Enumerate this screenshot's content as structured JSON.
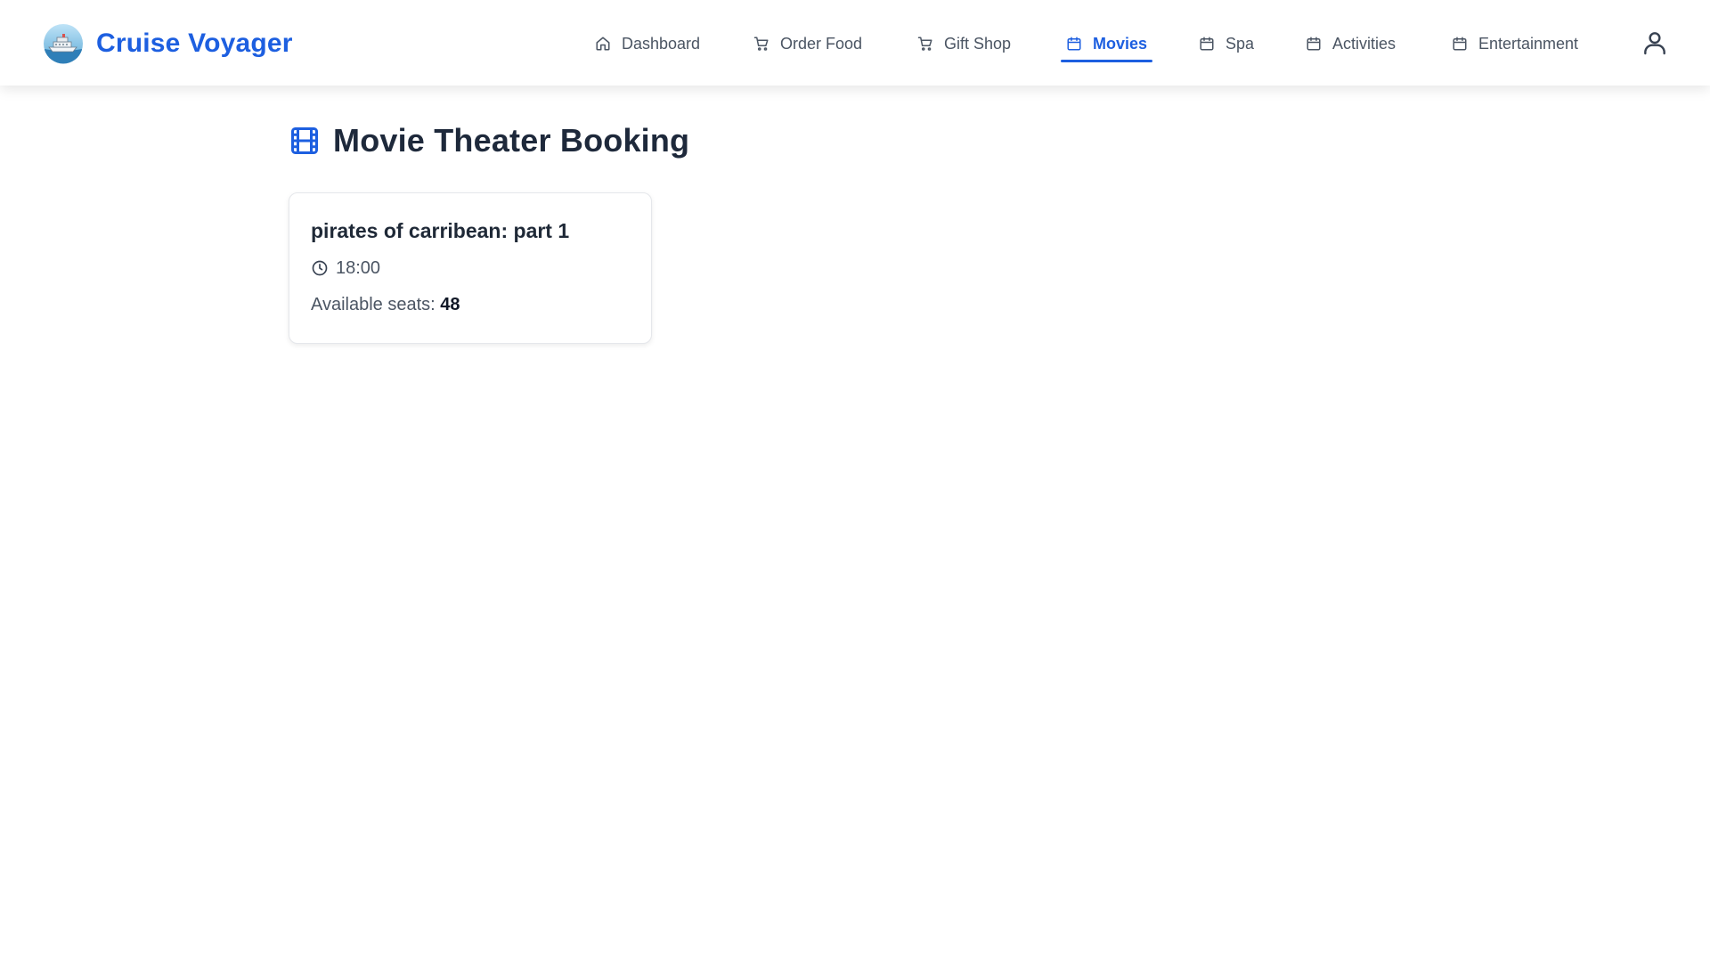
{
  "app": {
    "brand_name": "Cruise Voyager",
    "brand_logo_icon": "cruise-ship-icon",
    "accent_color": "#1d5fe0"
  },
  "nav": {
    "items": [
      {
        "label": "Dashboard",
        "icon": "home-icon",
        "active": false
      },
      {
        "label": "Order Food",
        "icon": "cart-icon",
        "active": false
      },
      {
        "label": "Gift Shop",
        "icon": "cart-icon",
        "active": false
      },
      {
        "label": "Movies",
        "icon": "calendar-icon",
        "active": true
      },
      {
        "label": "Spa",
        "icon": "calendar-icon",
        "active": false
      },
      {
        "label": "Activities",
        "icon": "calendar-icon",
        "active": false
      },
      {
        "label": "Entertainment",
        "icon": "calendar-icon",
        "active": false
      }
    ],
    "profile_icon": "user-icon"
  },
  "page": {
    "title": "Movie Theater Booking",
    "title_icon": "film-icon"
  },
  "movies": [
    {
      "title": "pirates of carribean: part 1",
      "time": "18:00",
      "time_icon": "clock-icon",
      "seats_label": "Available seats:",
      "seats_count": "48"
    }
  ]
}
